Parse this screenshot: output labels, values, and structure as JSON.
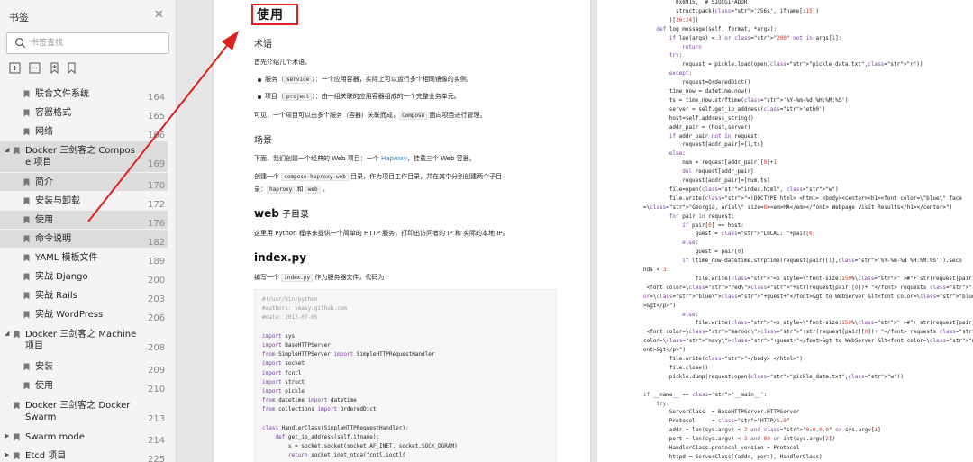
{
  "sidebar": {
    "title": "书签",
    "search_placeholder": "书签查找",
    "items": [
      {
        "label": "联合文件系统",
        "page": "164"
      },
      {
        "label": "容器格式",
        "page": "165"
      },
      {
        "label": "网络",
        "page": "166"
      },
      {
        "label_line1": "Docker 三剑客之 Compos",
        "label_line2": "e 项目",
        "page": "169"
      },
      {
        "label": "简介",
        "page": "170"
      },
      {
        "label": "安装与卸载",
        "page": "172"
      },
      {
        "label": "使用",
        "page": "176"
      },
      {
        "label": "命令说明",
        "page": "182"
      },
      {
        "label": "YAML 模板文件",
        "page": "189"
      },
      {
        "label": "实战 Django",
        "page": "200"
      },
      {
        "label": "实战 Rails",
        "page": "203"
      },
      {
        "label": "实战 WordPress",
        "page": "206"
      },
      {
        "label_line1": "Docker 三剑客之 Machine",
        "label_line2": "项目",
        "page": "208"
      },
      {
        "label": "安装",
        "page": "209"
      },
      {
        "label": "使用",
        "page": "210"
      },
      {
        "label_line1": "Docker 三剑客之 Docker",
        "label_line2": "Swarm",
        "page": "213"
      },
      {
        "label": "Swarm mode",
        "page": "214"
      },
      {
        "label": "Etcd 项目",
        "page": "225"
      }
    ]
  },
  "page1": {
    "title": "使用",
    "h_terms": "术语",
    "intro": "首先介绍几个术语。",
    "bullet1_a": "服务（",
    "bullet1_code": "service",
    "bullet1_b": "）：一个应用容器，实际上可以运行多个相同镜像的实例。",
    "bullet2_a": "项目（",
    "bullet2_code": "project",
    "bullet2_b": "）：由一组关联的应用容器组成的一个完整业务单元。",
    "summary_a": "可见，一个项目可以由多个服务（容器）关联而成，",
    "summary_code": "Compose",
    "summary_b": "面向项目进行管理。",
    "h_scene": "场景",
    "scene_a": "下面，我们创建一个经典的 Web 项目：一个",
    "scene_link": "Haproxy",
    "scene_b": "，挂载三个 Web 容器。",
    "create_a": "创建一个",
    "create_code": "compose-haproxy-web",
    "create_b": "目录，作为项目工作目录，并在其中分别创建两个子目",
    "create_c": "录：",
    "create_code2": "haproxy",
    "create_and": "和",
    "create_code3": "web",
    "create_end": "。",
    "h_web_a": "web",
    "h_web_b": " 子目录",
    "web_desc": "这里用 Python 程序来提供一个简单的 HTTP 服务，打印出访问者的 IP 和 实际的本地 IP。",
    "h_index": "index.py",
    "index_a": "编写一个",
    "index_code": "index.py",
    "index_b": "作为服务器文件，代码为",
    "code": [
      "#!/usr/bin/python",
      "#authors: yeasy.github.com",
      "#date: 2013-07-05",
      "",
      "import sys",
      "import BaseHTTPServer",
      "from SimpleHTTPServer import SimpleHTTPRequestHandler",
      "import socket",
      "import fcntl",
      "import struct",
      "import pickle",
      "from datetime import datetime",
      "from collections import OrderedDict",
      "",
      "class HandlerClass(SimpleHTTPRequestHandler):",
      "    def get_ip_address(self,ifname):",
      "        s = socket.socket(socket.AF_INET, socket.SOCK_DGRAM)",
      "        return socket.inet_ntoa(fcntl.ioctl("
    ]
  },
  "page2": {
    "lines": [
      {
        "indent": 10,
        "text": "0x8915,  # SIOCGIFADDR"
      },
      {
        "indent": 10,
        "text": "struct.pack('256s', ifname[:15])"
      },
      {
        "indent": 8,
        "text": ")[20:24])"
      },
      {
        "indent": 4,
        "text": "def log_message(self, format, *args):"
      },
      {
        "indent": 8,
        "text": "if len(args) < 3 or \"200\" not in args[1]:"
      },
      {
        "indent": 12,
        "text": "return"
      },
      {
        "indent": 8,
        "text": "try:"
      },
      {
        "indent": 12,
        "text": "request = pickle.load(open(\"pickle_data.txt\",\"r\"))"
      },
      {
        "indent": 8,
        "text": "except:"
      },
      {
        "indent": 12,
        "text": "request=OrderedDict()"
      },
      {
        "indent": 8,
        "text": "time_now = datetime.now()"
      },
      {
        "indent": 8,
        "text": "ts = time_now.strftime('%Y-%m-%d %H:%M:%S')"
      },
      {
        "indent": 8,
        "text": "server = self.get_ip_address('eth0')"
      },
      {
        "indent": 8,
        "text": "host=self.address_string()"
      },
      {
        "indent": 8,
        "text": "addr_pair = (host,server)"
      },
      {
        "indent": 8,
        "text": "if addr_pair not in request:"
      },
      {
        "indent": 12,
        "text": "request[addr_pair]=[1,ts]"
      },
      {
        "indent": 8,
        "text": "else:"
      },
      {
        "indent": 12,
        "text": "num = request[addr_pair][0]+1"
      },
      {
        "indent": 12,
        "text": "del request[addr_pair]"
      },
      {
        "indent": 12,
        "text": "request[addr_pair]=[num,ts]"
      },
      {
        "indent": 8,
        "text": "file=open(\"index.html\", \"w\")"
      },
      {
        "indent": 8,
        "text": "file.write(\"<!DOCTYPE html> <html> <body><center><h1><font color=\\\"blue\\\" face"
      },
      {
        "indent": 0,
        "text": "=\\\"Georgia, Arial\\\" size=8><em>HA</em></font> Webpage Visit Results</h1></center>\")"
      },
      {
        "indent": 8,
        "text": "for pair in request:"
      },
      {
        "indent": 12,
        "text": "if pair[0] == host:"
      },
      {
        "indent": 16,
        "text": "guest = \"LOCAL: \"+pair[0]"
      },
      {
        "indent": 12,
        "text": "else:"
      },
      {
        "indent": 16,
        "text": "guest = pair[0]"
      },
      {
        "indent": 12,
        "text": "if (time_now-datetime.strptime(request[pair][1],'%Y-%m-%d %H:%M:%S')).seco"
      },
      {
        "indent": 0,
        "text": "nds < 3:"
      },
      {
        "indent": 16,
        "text": "file.write(\"<p style=\\\"font-size:150%\\\" >#\"+ str(request[pair][1]) +\":"
      },
      {
        "indent": 0,
        "text": " <font color=\\\"red\\\">\"+str(request[pair][0])+ \"</font> requests \" + \"from &lt<font col"
      },
      {
        "indent": 0,
        "text": "or=\\\"blue\\\">\"+guest+\"</font>&gt to WebServer &lt<font color=\\\"blue\\\">\"+pair[1]+\"</font"
      },
      {
        "indent": 0,
        "text": ">&gt</p>\")"
      },
      {
        "indent": 12,
        "text": "else:"
      },
      {
        "indent": 16,
        "text": "file.write(\"<p style=\\\"font-size:150%\\\" >#\"+ str(request[pair][1]) +\":"
      },
      {
        "indent": 0,
        "text": " <font color=\\\"maroon\\\">\"+str(request[pair][0])+ \"</font> requests \" + \"from &lt<font"
      },
      {
        "indent": 0,
        "text": "color=\\\"navy\\\">\"+guest+\"</font>&gt to WebServer &lt<font color=\\\"navy\\\">\"+pair[1]+\"</f"
      },
      {
        "indent": 0,
        "text": "ont>&gt</p>\")"
      },
      {
        "indent": 8,
        "text": "file.write(\"</body> </html>\")"
      },
      {
        "indent": 8,
        "text": "file.close()"
      },
      {
        "indent": 8,
        "text": "pickle.dump(request,open(\"pickle_data.txt\",\"w\"))"
      },
      {
        "indent": 0,
        "text": ""
      },
      {
        "indent": 0,
        "text": "if __name__ == '__main__':"
      },
      {
        "indent": 4,
        "text": "try:"
      },
      {
        "indent": 8,
        "text": "ServerClass  = BaseHTTPServer.HTTPServer"
      },
      {
        "indent": 8,
        "text": "Protocol     = \"HTTP/1.0\""
      },
      {
        "indent": 8,
        "text": "addr = len(sys.argv) < 2 and \"0.0.0.0\" or sys.argv[1]"
      },
      {
        "indent": 8,
        "text": "port = len(sys.argv) < 3 and 80 or int(sys.argv[2])"
      },
      {
        "indent": 8,
        "text": "HandlerClass.protocol_version = Protocol"
      },
      {
        "indent": 8,
        "text": "httpd = ServerClass((addr, port), HandlerClass)"
      }
    ]
  },
  "colors": {
    "highlight": "#e0201c",
    "link": "#2b7bc9",
    "selected": "#dcdcdc"
  }
}
